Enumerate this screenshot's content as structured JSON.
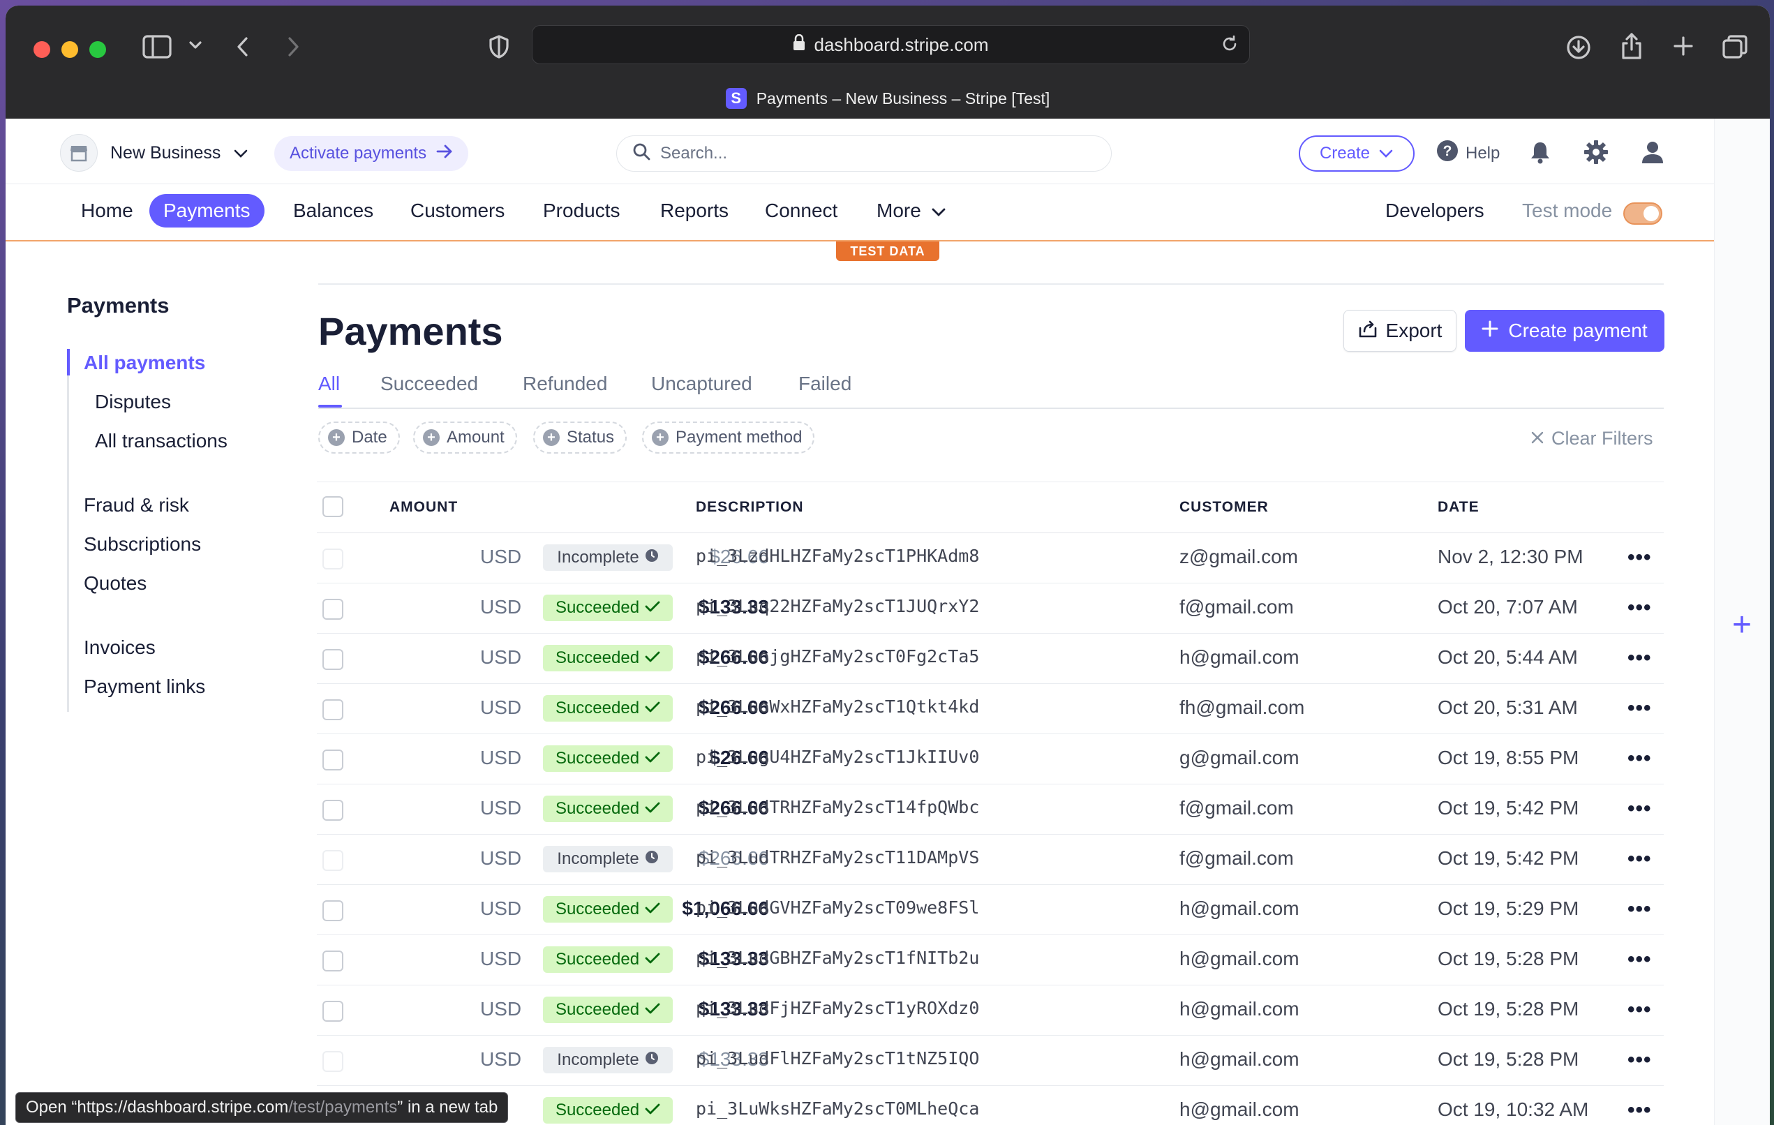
{
  "browser": {
    "url": "dashboard.stripe.com",
    "tab_title": "Payments – New Business – Stripe [Test]",
    "favicon_letter": "S",
    "status_prefix": "Open “https://dashboard.stripe.com",
    "status_path": "/test/payments",
    "status_suffix": "” in a new tab"
  },
  "header": {
    "business_name": "New Business",
    "activate_label": "Activate payments",
    "search_placeholder": "Search...",
    "create_label": "Create",
    "help_label": "Help"
  },
  "nav": {
    "items": [
      "Home",
      "Payments",
      "Balances",
      "Customers",
      "Products",
      "Reports",
      "Connect",
      "More"
    ],
    "active": "Payments",
    "developers_label": "Developers",
    "test_mode_label": "Test mode",
    "test_mode_on": true,
    "test_data_badge": "TEST DATA"
  },
  "sidebar": {
    "title": "Payments",
    "items": [
      "All payments",
      "Disputes",
      "All transactions",
      "Fraud & risk",
      "Subscriptions",
      "Quotes",
      "Invoices",
      "Payment links"
    ]
  },
  "main": {
    "title": "Payments",
    "export_label": "Export",
    "create_payment_label": "Create payment",
    "tabs": [
      "All",
      "Succeeded",
      "Refunded",
      "Uncaptured",
      "Failed"
    ],
    "active_tab": "All",
    "filters": [
      "Date",
      "Amount",
      "Status",
      "Payment method"
    ],
    "clear_filters_label": "Clear Filters",
    "columns": [
      "AMOUNT",
      "DESCRIPTION",
      "CUSTOMER",
      "DATE"
    ]
  },
  "rows": [
    {
      "amount": "$26.66",
      "currency": "USD",
      "status": "Incomplete",
      "description": "pi_3LzdHLHZFaMy2scT1PHKAdm8",
      "customer": "z@gmail.com",
      "date": "Nov 2, 12:30 PM"
    },
    {
      "amount": "$133.33",
      "currency": "USD",
      "status": "Succeeded",
      "description": "pi_3Luq22HZFaMy2scT1JUQrxY2",
      "customer": "f@gmail.com",
      "date": "Oct 20, 7:07 AM"
    },
    {
      "amount": "$266.66",
      "currency": "USD",
      "status": "Succeeded",
      "description": "pi_3LuojgHZFaMy2scT0Fg2cTa5",
      "customer": "h@gmail.com",
      "date": "Oct 20, 5:44 AM"
    },
    {
      "amount": "$266.66",
      "currency": "USD",
      "status": "Succeeded",
      "description": "pi_3LuoWxHZFaMy2scT1Qtkt4kd",
      "customer": "fh@gmail.com",
      "date": "Oct 20, 5:31 AM"
    },
    {
      "amount": "$26.66",
      "currency": "USD",
      "status": "Succeeded",
      "description": "pi_3LugU4HZFaMy2scT1JkIIUv0",
      "customer": "g@gmail.com",
      "date": "Oct 19, 8:55 PM"
    },
    {
      "amount": "$266.66",
      "currency": "USD",
      "status": "Succeeded",
      "description": "pi_3LudTRHZFaMy2scT14fpQWbc",
      "customer": "f@gmail.com",
      "date": "Oct 19, 5:42 PM"
    },
    {
      "amount": "$266.66",
      "currency": "USD",
      "status": "Incomplete",
      "description": "pi_3LudTRHZFaMy2scT11DAMpVS",
      "customer": "f@gmail.com",
      "date": "Oct 19, 5:42 PM"
    },
    {
      "amount": "$1,066.66",
      "currency": "USD",
      "status": "Succeeded",
      "description": "pi_3LudGVHZFaMy2scT09we8FSl",
      "customer": "h@gmail.com",
      "date": "Oct 19, 5:29 PM"
    },
    {
      "amount": "$133.33",
      "currency": "USD",
      "status": "Succeeded",
      "description": "pi_3LudGBHZFaMy2scT1fNITb2u",
      "customer": "h@gmail.com",
      "date": "Oct 19, 5:28 PM"
    },
    {
      "amount": "$133.33",
      "currency": "USD",
      "status": "Succeeded",
      "description": "pi_3LudFjHZFaMy2scT1yROXdz0",
      "customer": "h@gmail.com",
      "date": "Oct 19, 5:28 PM"
    },
    {
      "amount": "$133.33",
      "currency": "USD",
      "status": "Incomplete",
      "description": "pi_3LudFlHZFaMy2scT1tNZ5IQO",
      "customer": "h@gmail.com",
      "date": "Oct 19, 5:28 PM"
    },
    {
      "amount": "",
      "currency": "",
      "status": "Succeeded",
      "description": "pi_3LuWksHZFaMy2scT0MLheQca",
      "customer": "h@gmail.com",
      "date": "Oct 19, 10:32 AM"
    }
  ],
  "colors": {
    "accent": "#635bff",
    "success_bg": "#d7f7c2",
    "success_text": "#05690d",
    "test_orange": "#e8722e"
  }
}
